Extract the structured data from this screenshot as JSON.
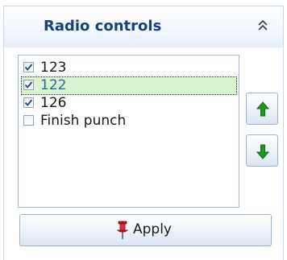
{
  "panel": {
    "title": "Radio controls",
    "collapse_icon": "double-chevron-up-icon"
  },
  "list": {
    "items": [
      {
        "label": "123",
        "checked": true,
        "selected": false
      },
      {
        "label": "122",
        "checked": true,
        "selected": true
      },
      {
        "label": "126",
        "checked": true,
        "selected": false
      },
      {
        "label": "Finish punch",
        "checked": false,
        "selected": false
      }
    ]
  },
  "buttons": {
    "move_up_icon": "green-arrow-up-icon",
    "move_down_icon": "green-arrow-down-icon",
    "apply_label": "Apply",
    "apply_icon": "pin-icon"
  },
  "colors": {
    "title": "#17407e",
    "selected_row": "#d9f4cf",
    "arrow": "#1f9a1f"
  }
}
